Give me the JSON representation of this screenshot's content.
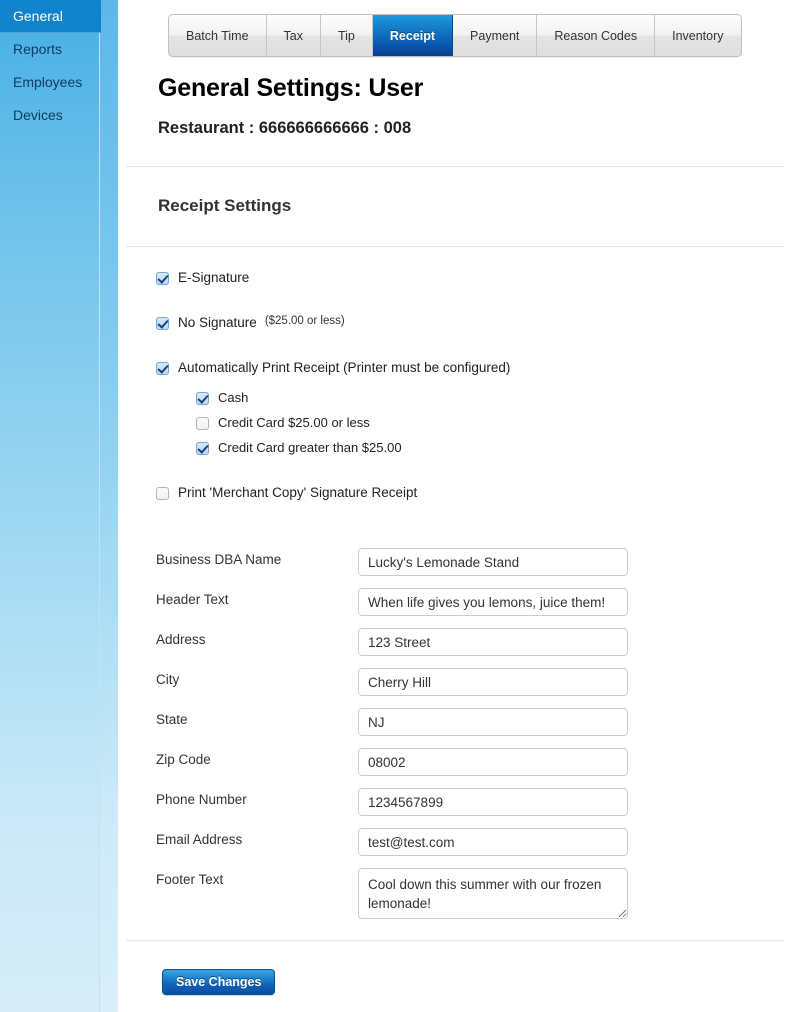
{
  "sidebar": {
    "items": [
      {
        "label": "General",
        "active": true
      },
      {
        "label": "Reports",
        "active": false
      },
      {
        "label": "Employees",
        "active": false
      },
      {
        "label": "Devices",
        "active": false
      }
    ]
  },
  "tabs": [
    {
      "label": "Batch Time",
      "active": false
    },
    {
      "label": "Tax",
      "active": false
    },
    {
      "label": "Tip",
      "active": false
    },
    {
      "label": "Receipt",
      "active": true
    },
    {
      "label": "Payment",
      "active": false
    },
    {
      "label": "Reason Codes",
      "active": false
    },
    {
      "label": "Inventory",
      "active": false
    }
  ],
  "header": {
    "title": "General Settings: User",
    "subtitle": "Restaurant : 666666666666 : 008"
  },
  "section": {
    "title": "Receipt Settings"
  },
  "checkboxes": {
    "e_signature": {
      "label": "E-Signature",
      "checked": true,
      "note": ""
    },
    "no_signature": {
      "label": "No Signature",
      "checked": true,
      "note": "($25.00 or less)"
    },
    "auto_print": {
      "label": "Automatically Print Receipt (Printer must be configured)",
      "checked": true,
      "note": ""
    },
    "cash": {
      "label": "Cash",
      "checked": true
    },
    "credit_card_under": {
      "label": "Credit Card $25.00 or less",
      "checked": false
    },
    "credit_card_over": {
      "label": "Credit Card greater than $25.00",
      "checked": true
    },
    "merchant_copy": {
      "label": "Print 'Merchant Copy' Signature Receipt",
      "checked": false
    }
  },
  "form": {
    "business_dba_name": {
      "label": "Business DBA Name",
      "value": "Lucky's Lemonade Stand"
    },
    "header_text": {
      "label": "Header Text",
      "value": "When life gives you lemons, juice them!"
    },
    "address": {
      "label": "Address",
      "value": "123 Street"
    },
    "city": {
      "label": "City",
      "value": "Cherry Hill"
    },
    "state": {
      "label": "State",
      "value": "NJ"
    },
    "zip_code": {
      "label": "Zip Code",
      "value": "08002"
    },
    "phone_number": {
      "label": "Phone Number",
      "value": "1234567899"
    },
    "email_address": {
      "label": "Email Address",
      "value": "test@test.com"
    },
    "footer_text": {
      "label": "Footer Text",
      "value": "Cool down this summer with our frozen lemonade!"
    }
  },
  "actions": {
    "save_label": "Save Changes"
  },
  "colors": {
    "sidebar_active": "#1183cd",
    "tab_active": "#0a59ae",
    "save_button": "#1c82cd"
  }
}
